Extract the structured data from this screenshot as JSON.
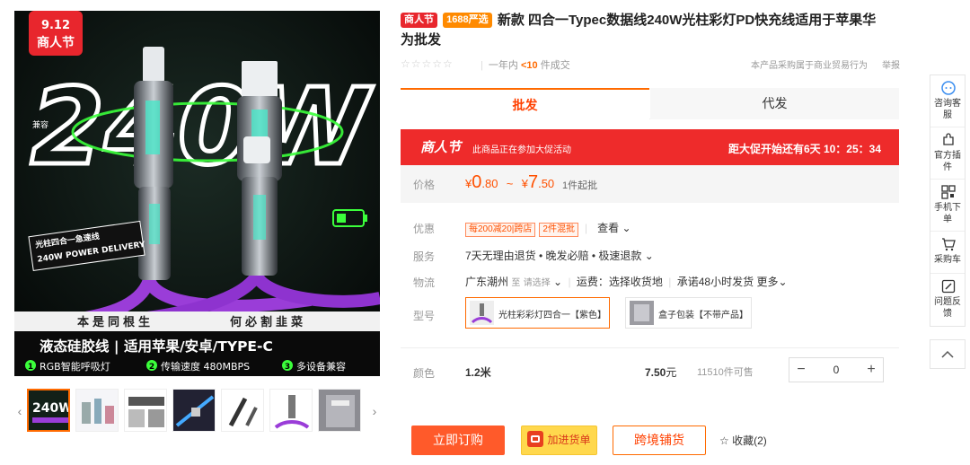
{
  "gallery": {
    "main_image": {
      "badge_date": "9.12",
      "badge_title": "商人节",
      "big_text": "240W",
      "compat_label": "兼容",
      "sticker_title": "光柱四合一急速线",
      "sticker_sub": "240W POWER DELIVERY",
      "band_left": "本是同根生",
      "band_right": "何必割韭菜",
      "slogan": "液态硅胶线 | 适用苹果/安卓/TYPE-C",
      "features": [
        "RGB智能呼吸灯",
        "传输速度 480MBPS",
        "多设备兼容"
      ],
      "feature_nums": [
        "1",
        "2",
        "3"
      ]
    },
    "thumb_count": 7,
    "prev": "‹",
    "next": "›"
  },
  "product": {
    "badge_festival": "商人节",
    "badge_selection": "1688严选",
    "title": "新款 四合一Typec数据线240W光柱彩灯PD快充线适用于苹果华为批发",
    "stars": "☆☆☆☆☆",
    "sales_prefix": "一年内",
    "sales_count": "<10",
    "sales_suffix": "件成交",
    "trade_note": "本产品采购属于商业贸易行为",
    "report": "举报"
  },
  "tabs": [
    {
      "label": "批发"
    },
    {
      "label": "代发"
    }
  ],
  "promo": {
    "logo": "商人节",
    "text": "此商品正在参加大促活动",
    "countdown": "距大促开始还有6天 10：25：34"
  },
  "price": {
    "label": "价格",
    "currency": "¥",
    "min_int": "0",
    "min_dec": ".80",
    "tilde": "~",
    "max_int": "7",
    "max_dec": ".50",
    "moq": "1件起批"
  },
  "discount": {
    "label": "优惠",
    "coupons": [
      "每200减20|跨店",
      "2件混批"
    ],
    "view": "查看"
  },
  "service": {
    "label": "服务",
    "text": "7天无理由退货 • 晚发必赔 • 极速退款"
  },
  "logistics": {
    "label": "物流",
    "origin": "广东潮州",
    "to": "至",
    "select": "请选择",
    "freight": "运费：选择收货地",
    "promise": "承诺48小时发货",
    "more": "更多"
  },
  "model": {
    "label": "型号",
    "options": [
      {
        "text": "光柱彩彩灯四合一【紫色】"
      },
      {
        "text": "盒子包装【不带产品】"
      }
    ]
  },
  "sku": {
    "label": "颜色",
    "name": "1.2米",
    "price": "7.50",
    "unit": "元",
    "stock": "11510件可售",
    "minus": "−",
    "qty": "0",
    "plus": "+"
  },
  "actions": {
    "buy": "立即订购",
    "cart": "加进货单",
    "shop": "跨境铺货",
    "fav_icon": "☆",
    "fav": "收藏(2)"
  },
  "sidebar": [
    {
      "label": "咨询客服",
      "icon": "chat-icon"
    },
    {
      "label": "官方插件",
      "icon": "puzzle-icon"
    },
    {
      "label": "手机下单",
      "icon": "qrcode-icon"
    },
    {
      "label": "采购车",
      "icon": "cart-icon"
    },
    {
      "label": "问题反馈",
      "icon": "feedback-icon"
    }
  ],
  "colors": {
    "accent": "#ff6a00",
    "promo_red": "#ee2b2b",
    "price": "#ff5000",
    "product_purple": "#9a3dd8",
    "neon_green": "#44ff44"
  }
}
